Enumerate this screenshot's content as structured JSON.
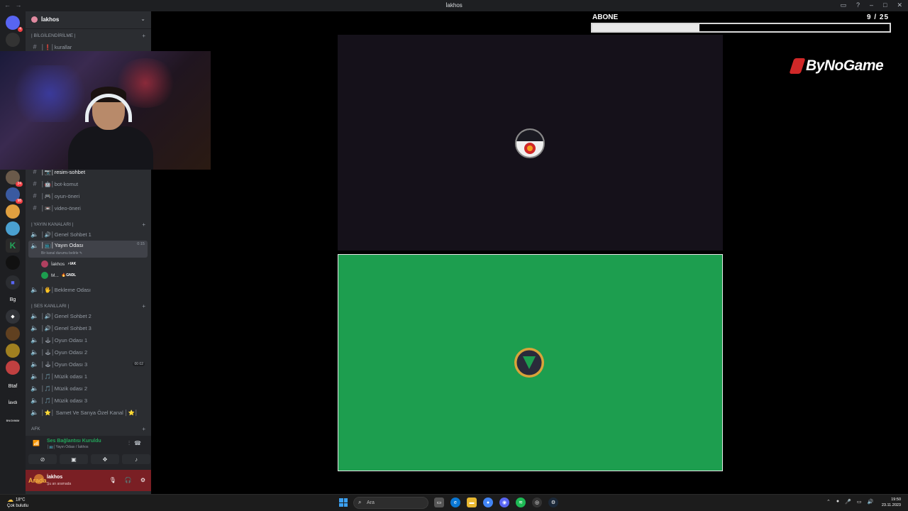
{
  "window": {
    "title": "İakhos",
    "nav": "← →"
  },
  "server": {
    "name": "İakhos"
  },
  "categories": {
    "info": "| BİLGİLENDİRİLME |",
    "stream": "| YAYIN KANALARI |",
    "voice": "| SES KANLLARI |",
    "afk": "AFK"
  },
  "channels": {
    "rules": "│❗│kurallar",
    "resim": "│📷│resim-sohbet",
    "bot": "│🤖│bot-komut",
    "oyun_oneri": "│🎮│oyun-öneri",
    "video_oneri": "│📼│video-öneri",
    "genel1": "│🔊│Genel Sohbet 1",
    "yayin": "│📺│Yayın Odası",
    "yayin_timer": "0:15",
    "yayin_status": "Bir kanal durumu belirle ✎",
    "bekleme": "│🖐│Bekleme Odası",
    "genel2": "│🔊│Genel Sohbet 2",
    "genel3": "│🔊│Genel Sohbet 3",
    "oyun1": "│🕹│Oyun Odası 1",
    "oyun2": "│🕹│Oyun Odası 2",
    "oyun3": "│🕹│Oyun Odası 3",
    "oyun3_count": "00 02",
    "muzik1": "│🎵│Müzik odası 1",
    "muzik2": "│🎵│Müzik odası 2",
    "muzik3": "│🎵│Müzik odası 3",
    "ozel": "│⭐│ Samet Ve Sarıya Özel Kanal │⭐│"
  },
  "voice_users": [
    {
      "name": "İakhos",
      "tag": "⚡IAK"
    },
    {
      "name": "M...",
      "tag": "🔥GNDL"
    }
  ],
  "voice_panel": {
    "status": "Ses Bağlantısı Kuruldu",
    "sub": "│📺│Yayın Odası / İakhos"
  },
  "user_panel": {
    "name": "İakhos",
    "status": "Şu an aramada",
    "watermark": "Arada"
  },
  "servers": [
    {
      "badge": "4",
      "color": "#5865f2"
    },
    {
      "badge": "",
      "color": "#333"
    },
    {
      "badge": "24",
      "color": "#6a5a4a"
    },
    {
      "badge": "98",
      "color": "#3a5aa0"
    },
    {
      "badge": "",
      "color": "#e0a040"
    },
    {
      "badge": "",
      "color": "#4aa0d0"
    },
    {
      "badge": "",
      "color": "#2a2a2a"
    },
    {
      "badge": "",
      "color": "#111"
    },
    {
      "badge": "",
      "color": "#5865f2"
    },
    {
      "label": "Bg",
      "color": "#1e1f22"
    },
    {
      "badge": "",
      "color": "#313338"
    },
    {
      "badge": "",
      "color": "#604020"
    },
    {
      "badge": "",
      "color": "#a08020"
    },
    {
      "badge": "",
      "color": "#c04040"
    },
    {
      "label": "Btaf",
      "color": "#1e1f22"
    },
    {
      "label": "İavdı",
      "color": "#1e1f22"
    },
    {
      "label": "BNGMMM",
      "color": "#1e1f22"
    }
  ],
  "overlay": {
    "abone_label": "ABONE",
    "abone_count": "9 / 25",
    "abone_current": 9,
    "abone_goal": 25,
    "brand": "ByNoGame"
  },
  "taskbar": {
    "weather_temp": "18°C",
    "weather_desc": "Çok bulutlu",
    "search_placeholder": "Ara",
    "time": "19:50",
    "date": "23.11.2023"
  },
  "colors": {
    "stream_green": "#1d9e4f",
    "connected_green": "#23a55a",
    "user_panel": "#7a1f24"
  }
}
